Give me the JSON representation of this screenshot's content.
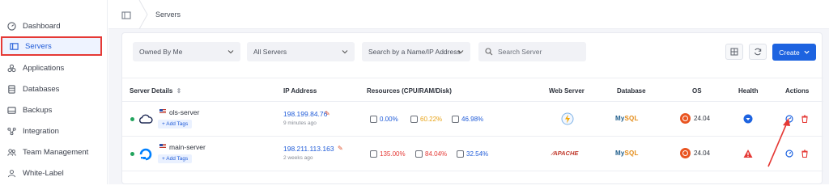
{
  "sidebar": {
    "items": [
      {
        "label": "Dashboard",
        "icon": "gauge-icon",
        "active": false
      },
      {
        "label": "Servers",
        "icon": "server-icon",
        "active": true
      },
      {
        "label": "Applications",
        "icon": "apps-icon",
        "active": false
      },
      {
        "label": "Databases",
        "icon": "database-icon",
        "active": false
      },
      {
        "label": "Backups",
        "icon": "backup-icon",
        "active": false
      },
      {
        "label": "Integration",
        "icon": "integration-icon",
        "active": false
      },
      {
        "label": "Team Management",
        "icon": "team-icon",
        "active": false
      },
      {
        "label": "White-Label",
        "icon": "white-label-icon",
        "active": false
      }
    ]
  },
  "breadcrumb": {
    "current": "Servers"
  },
  "filters": {
    "owner": "Owned By Me",
    "servers": "All Servers",
    "search_by": "Search by a Name/IP Address",
    "search_placeholder": "Search Server"
  },
  "toolbar": {
    "create_label": "Create"
  },
  "table": {
    "headers": {
      "details": "Server Details",
      "ip": "IP Address",
      "resources": "Resources (CPU/RAM/Disk)",
      "web_server": "Web Server",
      "database": "Database",
      "os": "OS",
      "health": "Health",
      "actions": "Actions"
    },
    "rows": [
      {
        "name": "ols-server",
        "tag": "+ Add Tags",
        "ip": "198.199.84.76",
        "created": "9 minutes ago",
        "cpu": "0.00%",
        "ram": "60.22%",
        "disk": "46.98%",
        "web_server": "litespeed-icon",
        "database_a": "My",
        "database_b": "SQL",
        "os_version": "24.04",
        "health": "ok"
      },
      {
        "name": "main-server",
        "tag": "+ Add Tags",
        "ip": "198.211.113.163",
        "created": "2 weeks ago",
        "cpu": "135.00%",
        "ram": "84.04%",
        "disk": "32.54%",
        "web_server": "APACHE",
        "database_a": "My",
        "database_b": "SQL",
        "os_version": "24.04",
        "health": "warning"
      }
    ]
  },
  "colors": {
    "accent": "#1d63e0",
    "online": "#22a45d",
    "danger": "#e53935",
    "warning": "#e8a317",
    "ubuntu": "#e95420"
  }
}
